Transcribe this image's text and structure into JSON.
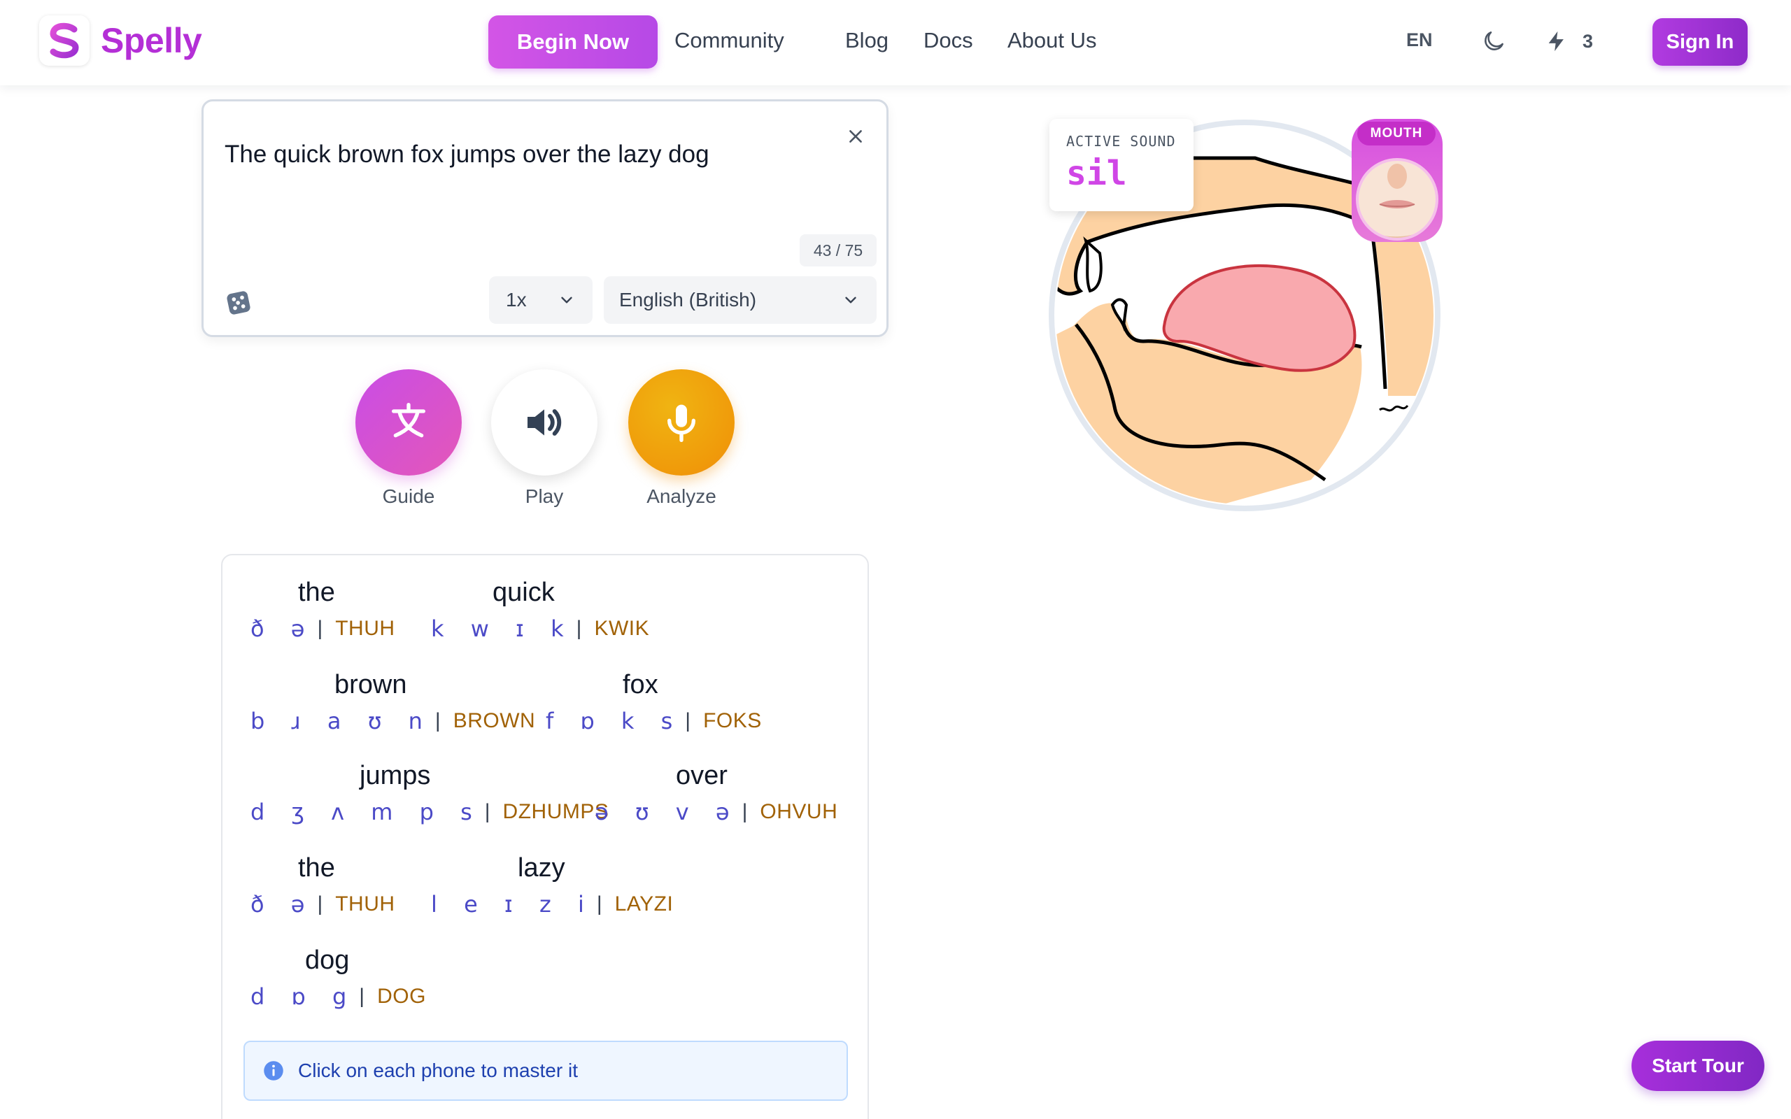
{
  "app": {
    "name": "Spelly"
  },
  "header": {
    "begin_label": "Begin Now",
    "nav": [
      "Community",
      "Blog",
      "Docs",
      "About Us"
    ],
    "language": "EN",
    "credits": "3",
    "signin_label": "Sign In"
  },
  "input": {
    "text": "The quick brown fox jumps over the lazy dog",
    "counter": "43 / 75",
    "speed": "1x",
    "accent": "English (British)"
  },
  "actions": {
    "guide": "Guide",
    "play": "Play",
    "analyze": "Analyze"
  },
  "transcription": {
    "rows": [
      [
        {
          "word": "the",
          "ipa": "ð ə",
          "respelling": "THUH"
        },
        {
          "word": "quick",
          "ipa": "k w ɪ k",
          "respelling": "KWIK"
        }
      ],
      [
        {
          "word": "brown",
          "ipa": "b ɹ a ʊ n",
          "respelling": "BROWN"
        },
        {
          "word": "fox",
          "ipa": "f ɒ k s",
          "respelling": "FOKS"
        }
      ],
      [
        {
          "word": "jumps",
          "ipa": "d ʒ ʌ m p s",
          "respelling": "DZHUMPS"
        },
        {
          "word": "over",
          "ipa": "ə ʊ v ə",
          "respelling": "OHVUH"
        }
      ],
      [
        {
          "word": "the",
          "ipa": "ð ə",
          "respelling": "THUH"
        },
        {
          "word": "lazy",
          "ipa": "l e ɪ z i",
          "respelling": "LAYZI"
        }
      ],
      [
        {
          "word": "dog",
          "ipa": "d ɒ g",
          "respelling": "DOG"
        }
      ]
    ],
    "separator": "|",
    "info": "Click on each phone to master it"
  },
  "diagram": {
    "active_label": "ACTIVE SOUND",
    "active_value": "sil",
    "mouth_tag": "MOUTH"
  },
  "tour_label": "Start Tour",
  "colors": {
    "brand": "#b42fd6",
    "ipa": "#4b4ac7",
    "respelling": "#a16207",
    "accent_pink": "#d046e6"
  }
}
